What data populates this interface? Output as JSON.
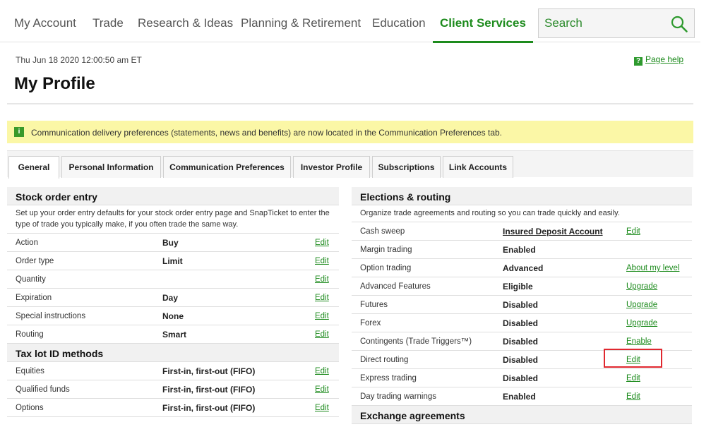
{
  "nav": {
    "items": [
      "My Account",
      "Trade",
      "Research & Ideas",
      "Planning & Retirement",
      "Education",
      "Client Services"
    ],
    "active": "Client Services",
    "search_placeholder": "Search"
  },
  "header": {
    "timestamp": "Thu Jun 18 2020 12:00:50 am ET",
    "page_help": "Page help",
    "title": "My Profile"
  },
  "notice": {
    "text": "Communication delivery preferences (statements, news and benefits) are now located in the Communication Preferences tab."
  },
  "tabs": [
    "General",
    "Personal Information",
    "Communication Preferences",
    "Investor Profile",
    "Subscriptions",
    "Link Accounts"
  ],
  "stock_order": {
    "title": "Stock order entry",
    "description": "Set up your order entry defaults for your stock order entry page and SnapTicket to enter the type of trade you typically make, if you often trade the same way.",
    "rows": [
      {
        "label": "Action",
        "value": "Buy",
        "action": "Edit"
      },
      {
        "label": "Order type",
        "value": "Limit",
        "action": "Edit"
      },
      {
        "label": "Quantity",
        "value": "",
        "action": "Edit"
      },
      {
        "label": "Expiration",
        "value": "Day",
        "action": "Edit"
      },
      {
        "label": "Special instructions",
        "value": "None",
        "action": "Edit"
      },
      {
        "label": "Routing",
        "value": "Smart",
        "action": "Edit"
      }
    ]
  },
  "tax_lot": {
    "title": "Tax lot ID methods",
    "rows": [
      {
        "label": "Equities",
        "value": "First-in, first-out (FIFO)",
        "action": "Edit"
      },
      {
        "label": "Qualified funds",
        "value": "First-in, first-out (FIFO)",
        "action": "Edit"
      },
      {
        "label": "Options",
        "value": "First-in, first-out (FIFO)",
        "action": "Edit"
      }
    ]
  },
  "elections": {
    "title": "Elections & routing",
    "description": "Organize trade agreements and routing so you can trade quickly and easily.",
    "rows": [
      {
        "label": "Cash sweep",
        "value": "Insured Deposit Account",
        "action": "Edit"
      },
      {
        "label": "Margin trading",
        "value": "Enabled",
        "action": ""
      },
      {
        "label": "Option trading",
        "value": "Advanced",
        "action": "About my level"
      },
      {
        "label": "Advanced Features",
        "value": "Eligible",
        "action": "Upgrade"
      },
      {
        "label": "Futures",
        "value": "Disabled",
        "action": "Upgrade"
      },
      {
        "label": "Forex",
        "value": "Disabled",
        "action": "Upgrade"
      },
      {
        "label": "Contingents (Trade Triggers™)",
        "value": "Disabled",
        "action": "Enable"
      },
      {
        "label": "Direct routing",
        "value": "Disabled",
        "action": "Edit"
      },
      {
        "label": "Express trading",
        "value": "Disabled",
        "action": "Edit"
      },
      {
        "label": "Day trading warnings",
        "value": "Enabled",
        "action": "Edit"
      }
    ]
  },
  "exchange": {
    "title": "Exchange agreements"
  },
  "colors": {
    "brand_green": "#1d8b1d",
    "notice_yellow": "#fbf7a6",
    "highlight_red": "#e0282f"
  }
}
